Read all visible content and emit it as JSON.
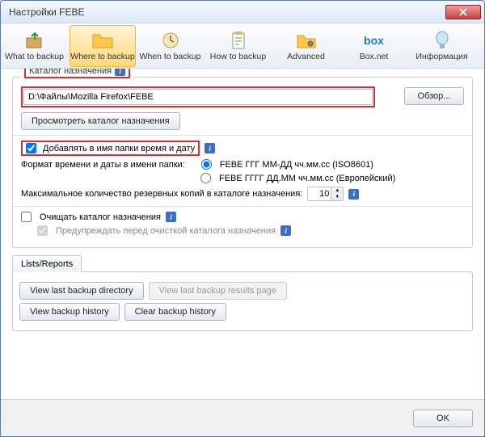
{
  "window": {
    "title": "Настройки FEBE"
  },
  "toolbar": {
    "items": [
      {
        "label": "What to backup"
      },
      {
        "label": "Where to backup"
      },
      {
        "label": "When to backup"
      },
      {
        "label": "How to backup"
      },
      {
        "label": "Advanced"
      },
      {
        "label": "Box.net"
      },
      {
        "label": "Информация"
      }
    ],
    "active_index": 1
  },
  "destination": {
    "group_label": "Каталог назначения",
    "path": "D:\\Файлы\\Mozilla Firefox\\FEBE",
    "browse_label": "Обзор...",
    "view_label": "Просмотреть каталог назначения"
  },
  "timestamp": {
    "checkbox_label": "Добавлять в имя папки время и дату",
    "checked": true,
    "format_label": "Формат времени и даты в имени папки:",
    "radio1": "FEBE ГГГ ММ-ДД чч.мм.сс (ISO8601)",
    "radio2": "FEBE ГГГГ ДД.ММ чч.мм.сс (Европейский)",
    "radio_selected": 0,
    "max_label": "Максимальное количество резервных копий в каталоге назначения:",
    "max_value": "10"
  },
  "cleanup": {
    "clear_label": "Очищать каталог назначения",
    "clear_checked": false,
    "warn_label": "Предупреждать перед очисткой каталога назначения",
    "warn_checked": true
  },
  "reports": {
    "tab_label": "Lists/Reports",
    "btn_view_dir": "View last backup directory",
    "btn_view_results": "View last backup results page",
    "btn_view_history": "View backup history",
    "btn_clear_history": "Clear backup history"
  },
  "footer": {
    "ok": "OK"
  },
  "icons": {
    "boxnet": "box"
  }
}
